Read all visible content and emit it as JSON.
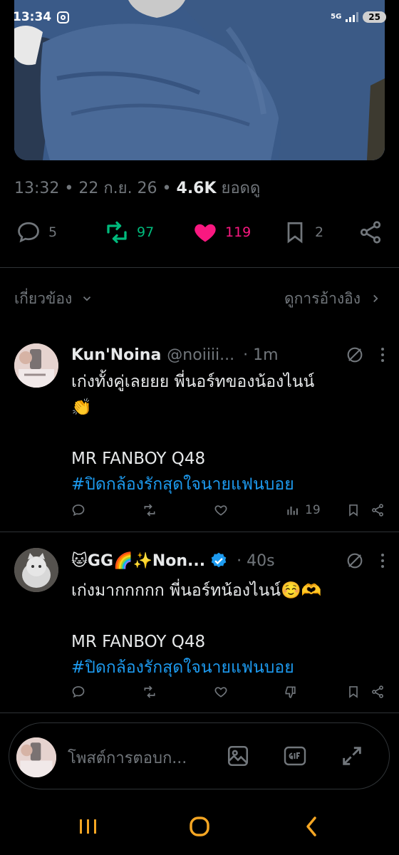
{
  "status": {
    "time": "13:34",
    "network": "5G",
    "battery": "25"
  },
  "post": {
    "time": "13:32",
    "date": "22 ก.ย. 26",
    "views_count": "4.6K",
    "views_label": "ยอดดู",
    "separator": " • ",
    "replies": "5",
    "reposts": "97",
    "likes": "119",
    "bookmarks": "2"
  },
  "relevance": {
    "sort_label": "เกี่ยวข้อง",
    "quotes_label": "ดูการอ้างอิง"
  },
  "replies": [
    {
      "name": "Kun'Noina",
      "handle": "@noiiii...",
      "time": "· 1m",
      "line1": "เก่งทั้งคู่เลยยย พี่นอร์ทของน้องไนน์",
      "line1_emoji": "👏",
      "line2": "MR FANBOY Q48",
      "hashtag": "#ปิดกล้องรักสุดใจนายแฟนบอย",
      "views": "19"
    },
    {
      "name": "🐱GG🌈✨Non...",
      "handle": "",
      "time": "· 40s",
      "line1": "เก่งมากกกกก พี่นอร์ทน้องไนน์☺️🫶",
      "line2": "MR FANBOY Q48",
      "hashtag": "#ปิดกล้องรักสุดใจนายแฟนบอย",
      "views": ""
    }
  ],
  "composer": {
    "placeholder": "โพสต์การตอบก..."
  },
  "colors": {
    "background": "#000000",
    "text": "#e7e9ea",
    "muted": "#71767b",
    "repost": "#00ba7c",
    "like": "#f91880",
    "link": "#1d9bf0",
    "nav": "#f5a623"
  }
}
